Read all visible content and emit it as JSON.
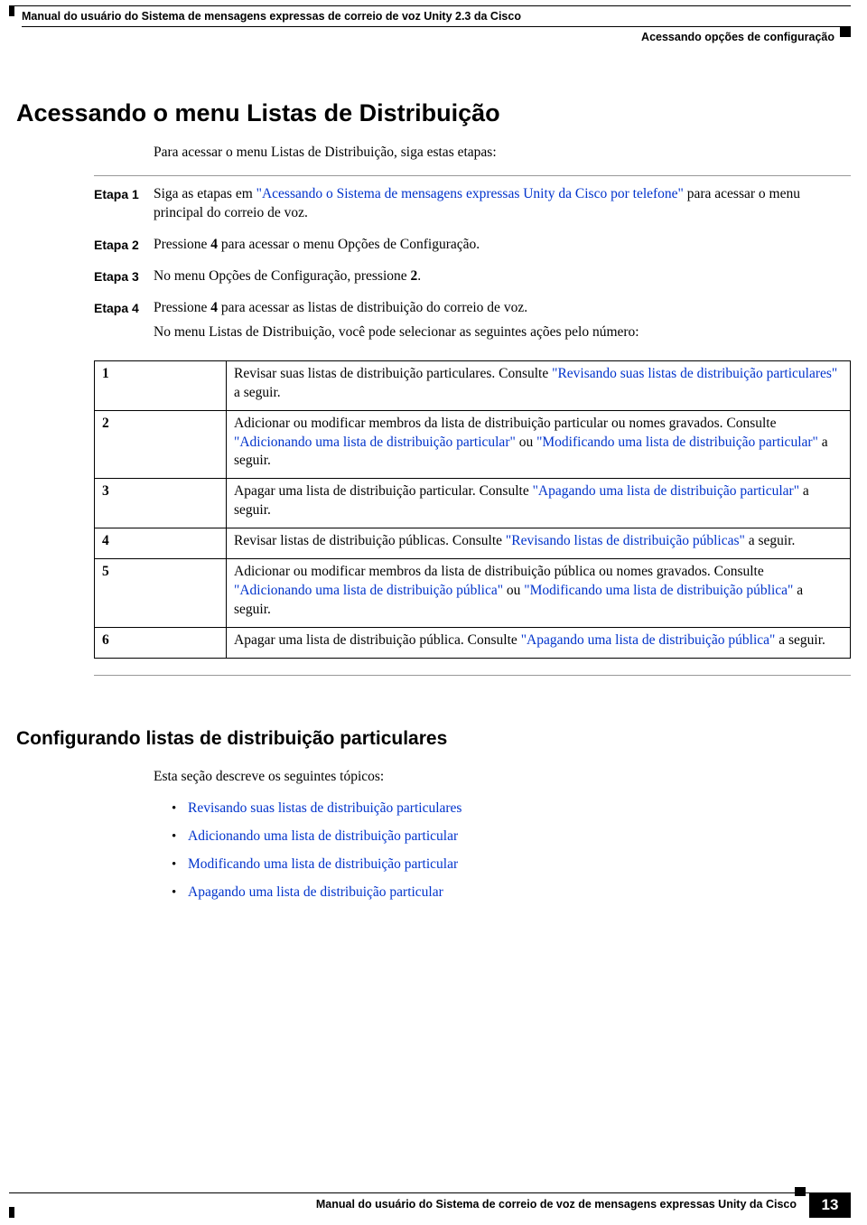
{
  "header": {
    "doc_title": "Manual do usuário do Sistema de mensagens expressas de correio de voz Unity 2.3 da Cisco",
    "section_path": "Acessando opções de configuração"
  },
  "h1": "Acessando o menu Listas de Distribuição",
  "intro": "Para acessar o menu Listas de Distribuição, siga estas etapas:",
  "steps": [
    {
      "label": "Etapa 1",
      "body_pre": "Siga as etapas em ",
      "link": "\"Acessando o Sistema de mensagens expressas Unity da Cisco por telefone\"",
      "body_post": " para acessar o menu principal do correio de voz."
    },
    {
      "label": "Etapa 2",
      "text_pre": "Pressione ",
      "bold": "4",
      "text_post": " para acessar o menu Opções de Configuração."
    },
    {
      "label": "Etapa 3",
      "text_pre": "No menu Opções de Configuração, pressione ",
      "bold": "2",
      "text_post": "."
    },
    {
      "label": "Etapa 4",
      "text_pre": "Pressione ",
      "bold": "4",
      "text_post": " para acessar as listas de distribuição do correio de voz.",
      "para2": "No menu Listas de Distribuição, você pode selecionar as seguintes ações pelo número:"
    }
  ],
  "table": [
    {
      "num": "1",
      "pre": "Revisar suas listas de distribuição particulares. Consulte ",
      "link1": "\"Revisando suas listas de distribuição particulares\"",
      "post": " a seguir."
    },
    {
      "num": "2",
      "pre": "Adicionar ou modificar membros da lista de distribuição particular ou nomes gravados. Consulte ",
      "link1": "\"Adicionando uma lista de distribuição particular\"",
      "mid": " ou ",
      "link2": "\"Modificando uma lista de distribuição particular\"",
      "post": " a seguir."
    },
    {
      "num": "3",
      "pre": "Apagar uma lista de distribuição particular. Consulte ",
      "link1": "\"Apagando uma lista de distribuição particular\"",
      "post": " a seguir."
    },
    {
      "num": "4",
      "pre": "Revisar listas de distribuição públicas. Consulte ",
      "link1": "\"Revisando listas de distribuição públicas\"",
      "post": " a seguir."
    },
    {
      "num": "5",
      "pre": "Adicionar ou modificar membros da lista de distribuição pública ou nomes gravados. Consulte ",
      "link1": "\"Adicionando uma lista de distribuição pública\"",
      "mid": " ou ",
      "link2": "\"Modificando uma lista de distribuição pública\"",
      "post": " a seguir."
    },
    {
      "num": "6",
      "pre": "Apagar uma lista de distribuição pública. Consulte ",
      "link1": "\"Apagando uma lista de distribuição pública\"",
      "post": " a seguir."
    }
  ],
  "h2": "Configurando listas de distribuição particulares",
  "sec2_intro": "Esta seção descreve os seguintes tópicos:",
  "bullets": [
    "Revisando suas listas de distribuição particulares",
    "Adicionando uma lista de distribuição particular",
    "Modificando uma lista de distribuição particular",
    "Apagando uma lista de distribuição particular"
  ],
  "footer": {
    "text": "Manual do usuário do Sistema de correio de voz de mensagens expressas Unity da Cisco",
    "page": "13"
  }
}
